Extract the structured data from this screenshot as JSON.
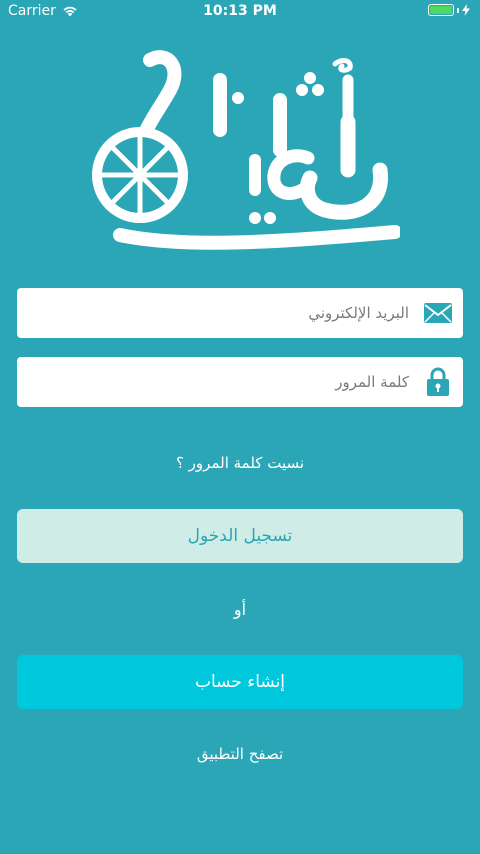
{
  "status_bar": {
    "carrier": "Carrier",
    "time": "10:13 PM"
  },
  "logo": {
    "text": "تأهيل",
    "icon": "wheelchair-wheel-logo"
  },
  "form": {
    "email": {
      "placeholder": "البريد الإلكتروني",
      "icon": "envelope-icon"
    },
    "password": {
      "placeholder": "كلمة المرور",
      "icon": "lock-icon"
    }
  },
  "forgot_password": "نسيت كلمة المرور ؟",
  "login_button": "تسجيل الدخول",
  "or_label": "أو",
  "create_account_button": "إنشاء حساب",
  "browse_app": "تصفح التطبيق",
  "colors": {
    "background": "#2aa6b6",
    "login_button_bg": "#cfece7",
    "create_button_bg": "#00c8dc",
    "battery": "#4cd964"
  }
}
